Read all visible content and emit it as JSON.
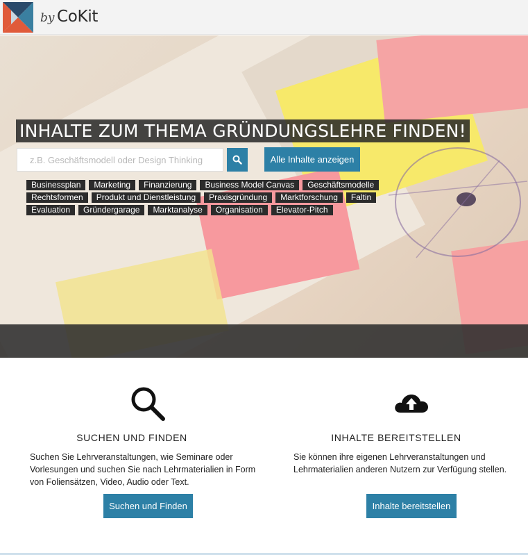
{
  "header": {
    "brand_prefix": "by",
    "brand_name": "CoKit"
  },
  "hero": {
    "title": "INHALTE ZUM THEMA GRÜNDUNGSLEHRE FINDEN!",
    "search_placeholder": "z.B. Geschäftsmodell oder Design Thinking",
    "search_value": "",
    "all_button_label": "Alle Inhalte anzeigen",
    "tag_rows": [
      [
        "Businessplan",
        "Marketing",
        "Finanzierung",
        "Business Model Canvas",
        "Geschäftsmodelle"
      ],
      [
        "Rechtsformen",
        "Produkt und Dienstleistung",
        "Praxisgründung",
        "Marktforschung",
        "Faltin"
      ],
      [
        "Evaluation",
        "Gründergarage",
        "Marktanalyse",
        "Organisation",
        "Elevator-Pitch"
      ]
    ]
  },
  "features": {
    "search": {
      "title": "SUCHEN UND FINDEN",
      "text_lines": [
        "Suchen Sie Lehrveranstaltungen, wie Seminare oder",
        "Vorlesungen und suchen Sie nach Lehrmaterialien in Form",
        "von Foliensätzen, Video, Audio oder Text."
      ],
      "button_label": "Suchen und Finden",
      "icon": "search-icon"
    },
    "provide": {
      "title": "INHALTE BEREITSTELLEN",
      "text_lines": [
        "Sie können ihre eigenen Lehrveranstaltungen und",
        "Lehrmaterialien anderen Nutzern zur Verfügung stellen."
      ],
      "button_label": "Inhalte bereitstellen",
      "icon": "cloud-upload-icon"
    }
  },
  "colors": {
    "accent": "#2d80a6",
    "tag_bg": "#2b2b2b",
    "header_bg": "#f3f3f3"
  }
}
